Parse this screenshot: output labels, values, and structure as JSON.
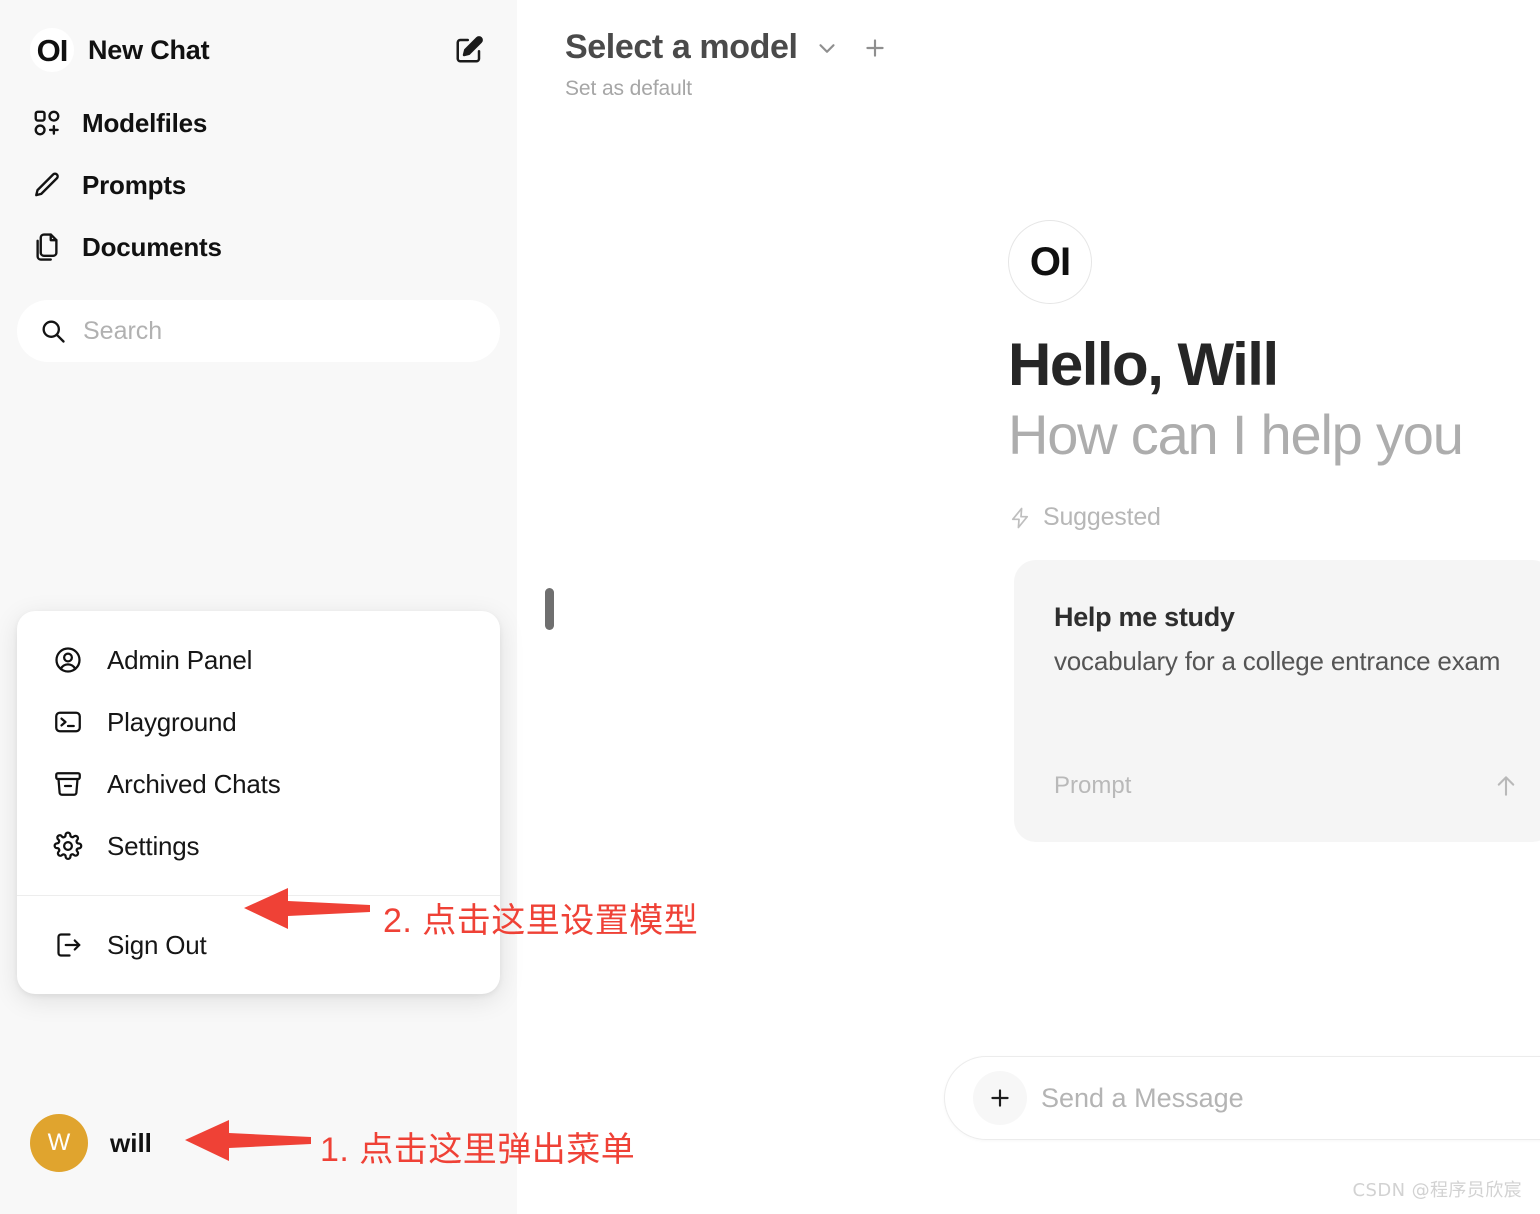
{
  "colors": {
    "sidebar_bg": "#f8f8f8",
    "main_bg": "#ffffff",
    "annotation_red": "#ef4136",
    "avatar_bg": "#e0a42e",
    "card_bg": "#f5f5f5",
    "muted_text": "#adadad"
  },
  "sidebar": {
    "logo_text": "OI",
    "new_chat_label": "New Chat",
    "edit_icon": "edit-square-icon",
    "nav_items": [
      {
        "label": "Modelfiles",
        "icon": "modelfiles-grid-plus-icon"
      },
      {
        "label": "Prompts",
        "icon": "pencil-icon"
      },
      {
        "label": "Documents",
        "icon": "documents-copy-icon"
      }
    ],
    "search": {
      "placeholder": "Search",
      "value": "",
      "icon": "search-icon"
    },
    "user": {
      "avatar_initial": "W",
      "name": "will"
    }
  },
  "user_menu": {
    "groups": [
      {
        "items": [
          {
            "label": "Admin Panel",
            "icon": "user-circle-icon"
          },
          {
            "label": "Playground",
            "icon": "terminal-icon"
          },
          {
            "label": "Archived Chats",
            "icon": "archive-box-icon"
          },
          {
            "label": "Settings",
            "icon": "gear-icon"
          }
        ]
      },
      {
        "items": [
          {
            "label": "Sign Out",
            "icon": "sign-out-icon"
          }
        ]
      }
    ]
  },
  "main": {
    "model_selector": {
      "title": "Select a model",
      "chevron_icon": "chevron-down-icon",
      "add_icon": "plus-icon",
      "set_default_label": "Set as default"
    },
    "greeting": {
      "logo_text": "OI",
      "hello": "Hello, Will",
      "subtitle": "How can I help you"
    },
    "suggested": {
      "header_label": "Suggested",
      "header_icon": "lightning-bolt-icon",
      "cards": [
        {
          "title": "Help me study",
          "description": "vocabulary for a college entrance exam",
          "footer_label": "Prompt",
          "footer_icon": "arrow-up-icon"
        }
      ]
    },
    "composer": {
      "add_icon": "plus-icon",
      "placeholder": "Send a Message",
      "value": ""
    }
  },
  "annotations": [
    {
      "id": "step-1",
      "text": "1. 点击这里弹出菜单",
      "arrow": "left-arrow"
    },
    {
      "id": "step-2",
      "text": "2. 点击这里设置模型",
      "arrow": "left-arrow"
    }
  ],
  "watermark": "CSDN @程序员欣宸"
}
